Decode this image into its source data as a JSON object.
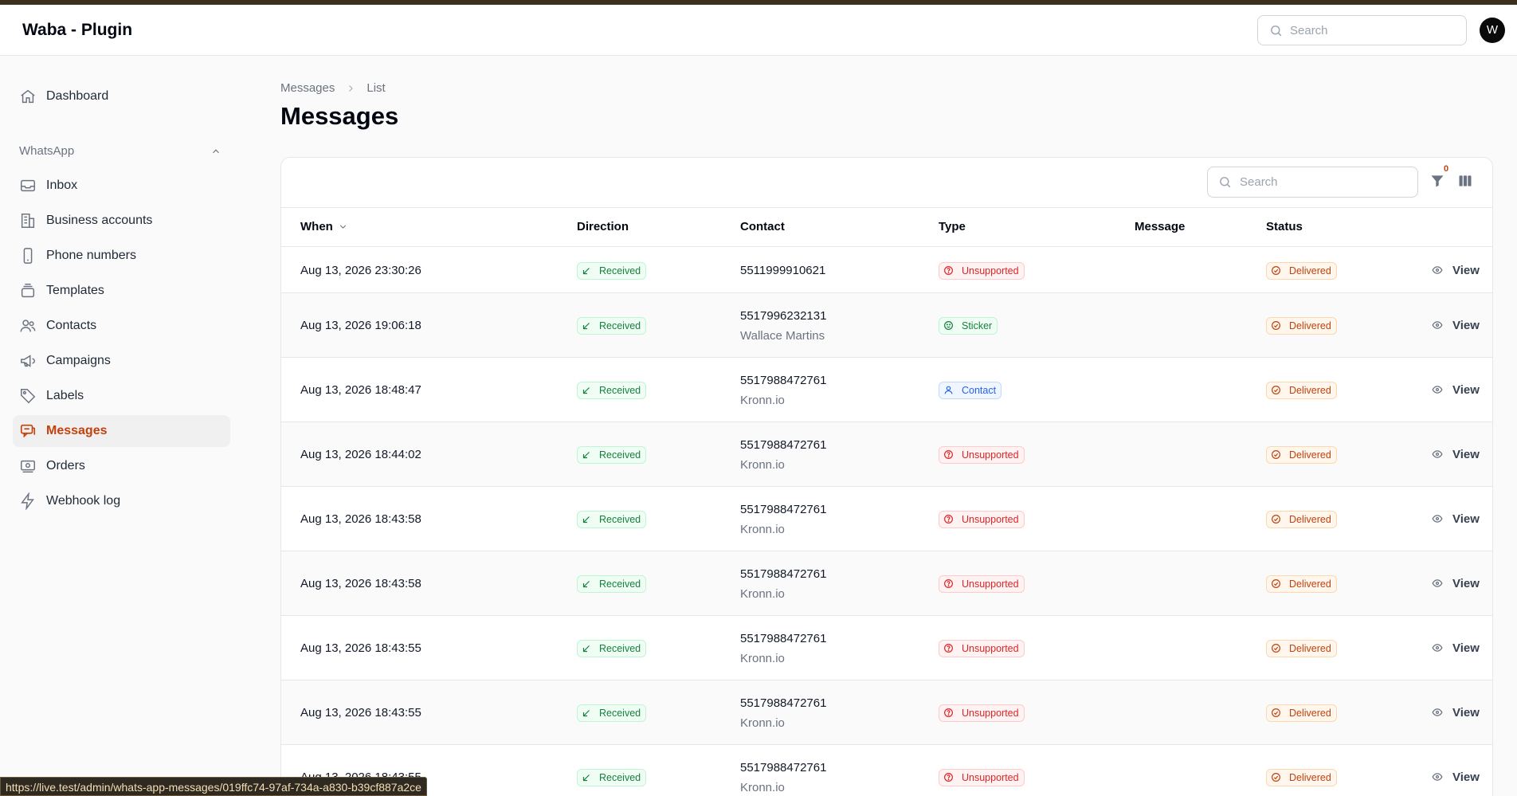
{
  "app": {
    "title": "Waba - Plugin",
    "avatar_initial": "W"
  },
  "topbar": {
    "search_placeholder": "Search"
  },
  "sidebar": {
    "dashboard": "Dashboard",
    "group_label": "WhatsApp",
    "items": [
      {
        "label": "Inbox",
        "icon": "inbox-icon"
      },
      {
        "label": "Business accounts",
        "icon": "building-icon"
      },
      {
        "label": "Phone numbers",
        "icon": "phone-icon"
      },
      {
        "label": "Templates",
        "icon": "stack-icon"
      },
      {
        "label": "Contacts",
        "icon": "users-icon"
      },
      {
        "label": "Campaigns",
        "icon": "megaphone-icon"
      },
      {
        "label": "Labels",
        "icon": "tag-icon"
      },
      {
        "label": "Messages",
        "icon": "chat-icon",
        "active": true
      },
      {
        "label": "Orders",
        "icon": "cash-icon"
      },
      {
        "label": "Webhook log",
        "icon": "bolt-icon"
      }
    ]
  },
  "breadcrumb": {
    "parent": "Messages",
    "current": "List"
  },
  "page": {
    "title": "Messages"
  },
  "table": {
    "search_placeholder": "Search",
    "filter_count": "0",
    "columns": {
      "when": "When",
      "direction": "Direction",
      "contact": "Contact",
      "type": "Type",
      "message": "Message",
      "status": "Status"
    },
    "view_label": "View",
    "rows": [
      {
        "when": "Aug 13, 2026 23:30:26",
        "direction": "Received",
        "contact_number": "5511999910621",
        "contact_name": "",
        "type": "Unsupported",
        "type_kind": "unsupported",
        "status": "Delivered"
      },
      {
        "when": "Aug 13, 2026 19:06:18",
        "direction": "Received",
        "contact_number": "5517996232131",
        "contact_name": "Wallace Martins",
        "type": "Sticker",
        "type_kind": "sticker",
        "status": "Delivered"
      },
      {
        "when": "Aug 13, 2026 18:48:47",
        "direction": "Received",
        "contact_number": "5517988472761",
        "contact_name": "Kronn.io",
        "type": "Contact",
        "type_kind": "contact",
        "status": "Delivered"
      },
      {
        "when": "Aug 13, 2026 18:44:02",
        "direction": "Received",
        "contact_number": "5517988472761",
        "contact_name": "Kronn.io",
        "type": "Unsupported",
        "type_kind": "unsupported",
        "status": "Delivered"
      },
      {
        "when": "Aug 13, 2026 18:43:58",
        "direction": "Received",
        "contact_number": "5517988472761",
        "contact_name": "Kronn.io",
        "type": "Unsupported",
        "type_kind": "unsupported",
        "status": "Delivered"
      },
      {
        "when": "Aug 13, 2026 18:43:58",
        "direction": "Received",
        "contact_number": "5517988472761",
        "contact_name": "Kronn.io",
        "type": "Unsupported",
        "type_kind": "unsupported",
        "status": "Delivered"
      },
      {
        "when": "Aug 13, 2026 18:43:55",
        "direction": "Received",
        "contact_number": "5517988472761",
        "contact_name": "Kronn.io",
        "type": "Unsupported",
        "type_kind": "unsupported",
        "status": "Delivered"
      },
      {
        "when": "Aug 13, 2026 18:43:55",
        "direction": "Received",
        "contact_number": "5517988472761",
        "contact_name": "Kronn.io",
        "type": "Unsupported",
        "type_kind": "unsupported",
        "status": "Delivered"
      },
      {
        "when": "Aug 13, 2026 18:43:55",
        "direction": "Received",
        "contact_number": "5517988472761",
        "contact_name": "Kronn.io",
        "type": "Unsupported",
        "type_kind": "unsupported",
        "status": "Delivered"
      }
    ]
  },
  "statusbar": {
    "url": "https://live.test/admin/whats-app-messages/019ffc74-97af-734a-a830-b39cf887a2ce"
  }
}
